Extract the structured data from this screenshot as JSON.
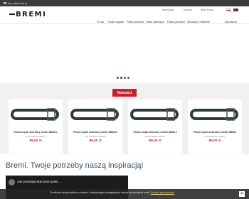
{
  "topbar": {
    "email": "biuro@bremi.pl"
  },
  "header": {
    "logo": "BREMI",
    "utility": {
      "wishlist": "Wunschat",
      "cart": "Koszyk",
      "account": "Moje Konto"
    },
    "nav": [
      "O nas",
      "Paski męskie",
      "Paski damskie",
      "Paski dziecięce",
      "Paski parciane",
      "Obcasiki i mittlerne",
      "Akcesoria"
    ]
  },
  "slider": {
    "dots": 4,
    "active_index": 1
  },
  "news": {
    "badge": "Nowości",
    "products": [
      {
        "name": "Pasek męski skórzany model AB38-L",
        "code": "kod produktu: AB38-L",
        "price": "89,00 zł"
      },
      {
        "name": "Pasek męski skórzany model AB38-K",
        "code": "kod produktu: AB38-K",
        "price": "89,00 zł"
      },
      {
        "name": "Pasek męski skórzany model AB38-J",
        "code": "kod produktu: AB38-J",
        "price": "89,00 zł"
      },
      {
        "name": "Pasek męski skórzany model AB38-I",
        "code": "kod produktu: AB38-I",
        "price": "89,00 zł"
      }
    ]
  },
  "tagline": "Bremi. Twoje potrzeby naszą inspiracją!",
  "video": {
    "title": "Jak powstają skórzane paski..."
  },
  "cookie": {
    "text": "Ta strona używa plików cookies. Kontynuując przeglądanie strony akceptujesz treść",
    "link": "Polityki prywatności",
    "close": "✕"
  },
  "colors": {
    "accent": "#c7202f",
    "topbar": "#3a3a3a",
    "tagline": "#3d4e69",
    "price": "#c7202f"
  }
}
